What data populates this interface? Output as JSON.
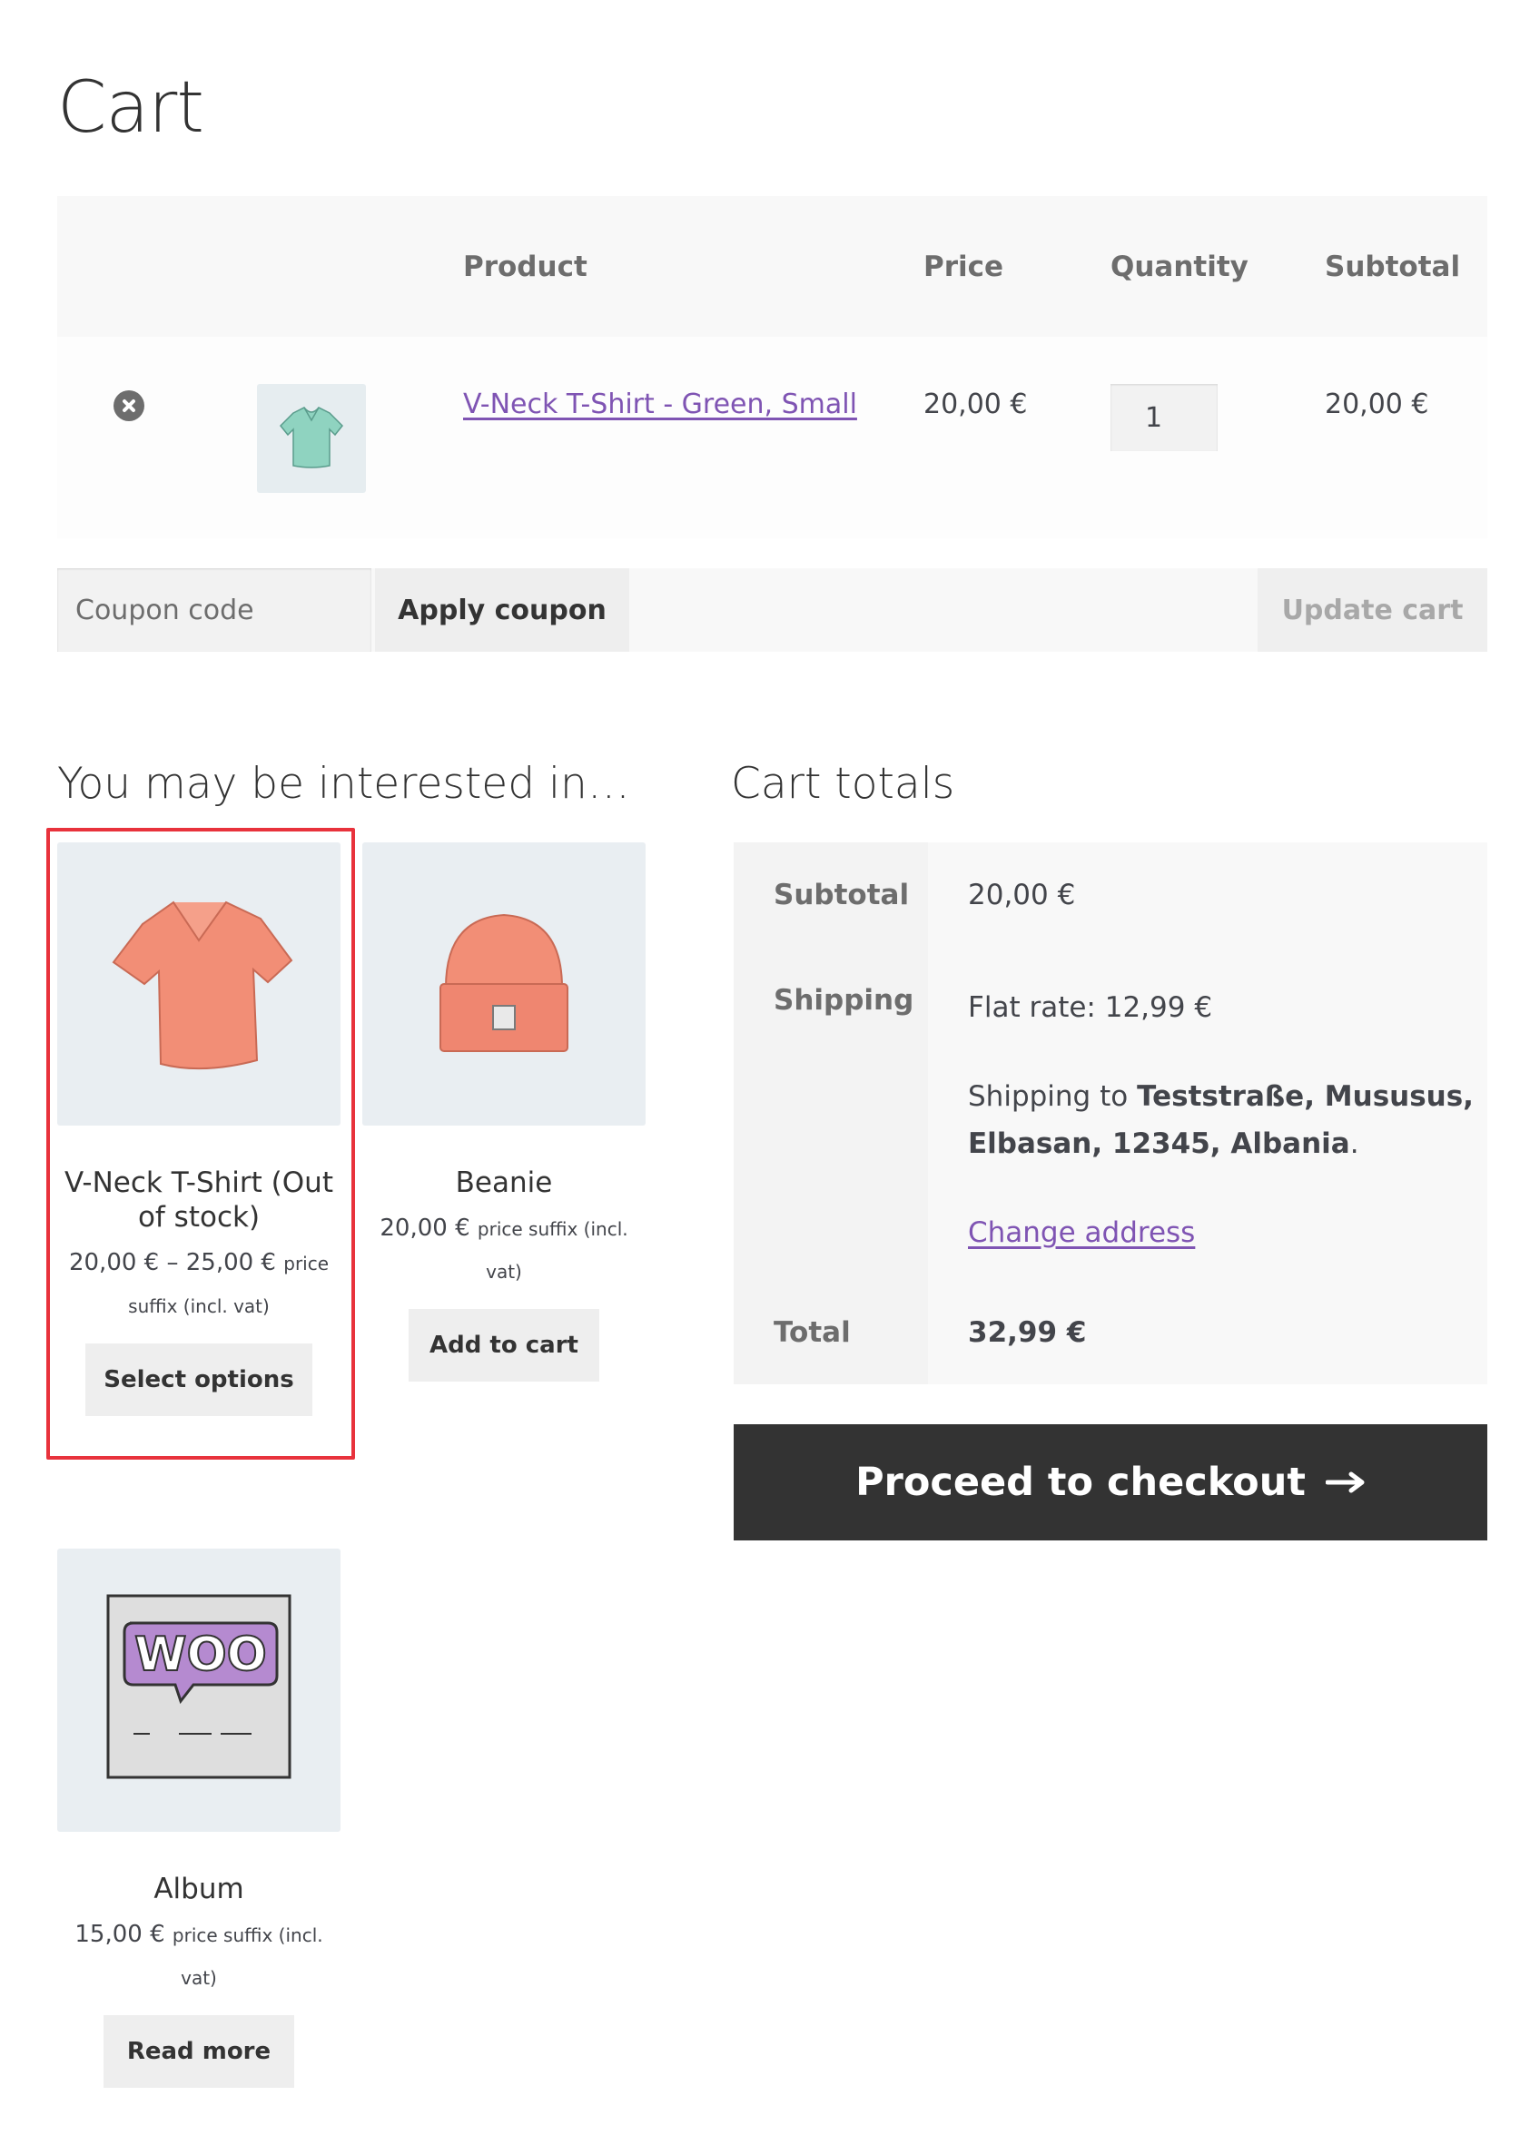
{
  "page": {
    "title": "Cart"
  },
  "cart_table": {
    "headers": {
      "product": "Product",
      "price": "Price",
      "quantity": "Quantity",
      "subtotal": "Subtotal"
    },
    "rows": [
      {
        "product_name": "V-Neck T-Shirt - Green, Small",
        "price": "20,00 €",
        "quantity": "1",
        "subtotal": "20,00 €",
        "thumbnail_icon": "tshirt-icon",
        "thumbnail_color": "#8fd3c0"
      }
    ]
  },
  "actions": {
    "coupon_placeholder": "Coupon code",
    "apply_coupon": "Apply coupon",
    "update_cart": "Update cart"
  },
  "cross_sells": {
    "title": "You may be interested in…",
    "products": [
      {
        "name": "V-Neck T-Shirt (Out of stock)",
        "price": "20,00 € – 25,00 €",
        "price_suffix": "price suffix (incl. vat)",
        "button": "Select options",
        "image_icon": "vneck-tshirt-icon",
        "highlighted": true
      },
      {
        "name": "Beanie",
        "price": "20,00 €",
        "price_suffix": "price suffix (incl. vat)",
        "button": "Add to cart",
        "image_icon": "beanie-icon"
      },
      {
        "name": "Album",
        "price": "15,00 €",
        "price_suffix": "price suffix (incl. vat)",
        "button": "Read more",
        "image_icon": "woo-album-icon"
      }
    ]
  },
  "cart_totals": {
    "title": "Cart totals",
    "subtotal_label": "Subtotal",
    "subtotal_value": "20,00 €",
    "shipping_label": "Shipping",
    "shipping_method": "Flat rate: 12,99 €",
    "shipping_to_prefix": "Shipping to",
    "shipping_to_line1": "Teststraße, Mususus,",
    "shipping_to_line2": "Elbasan, 12345, Albania",
    "change_address": "Change address",
    "total_label": "Total",
    "total_value": "32,99 €"
  },
  "checkout": {
    "label": "Proceed to checkout",
    "icon": "arrow-right-icon"
  },
  "colors": {
    "link": "#7f54b3",
    "dark_button": "#333333",
    "highlight": "#e8323c",
    "product_coral": "#f28e76"
  }
}
